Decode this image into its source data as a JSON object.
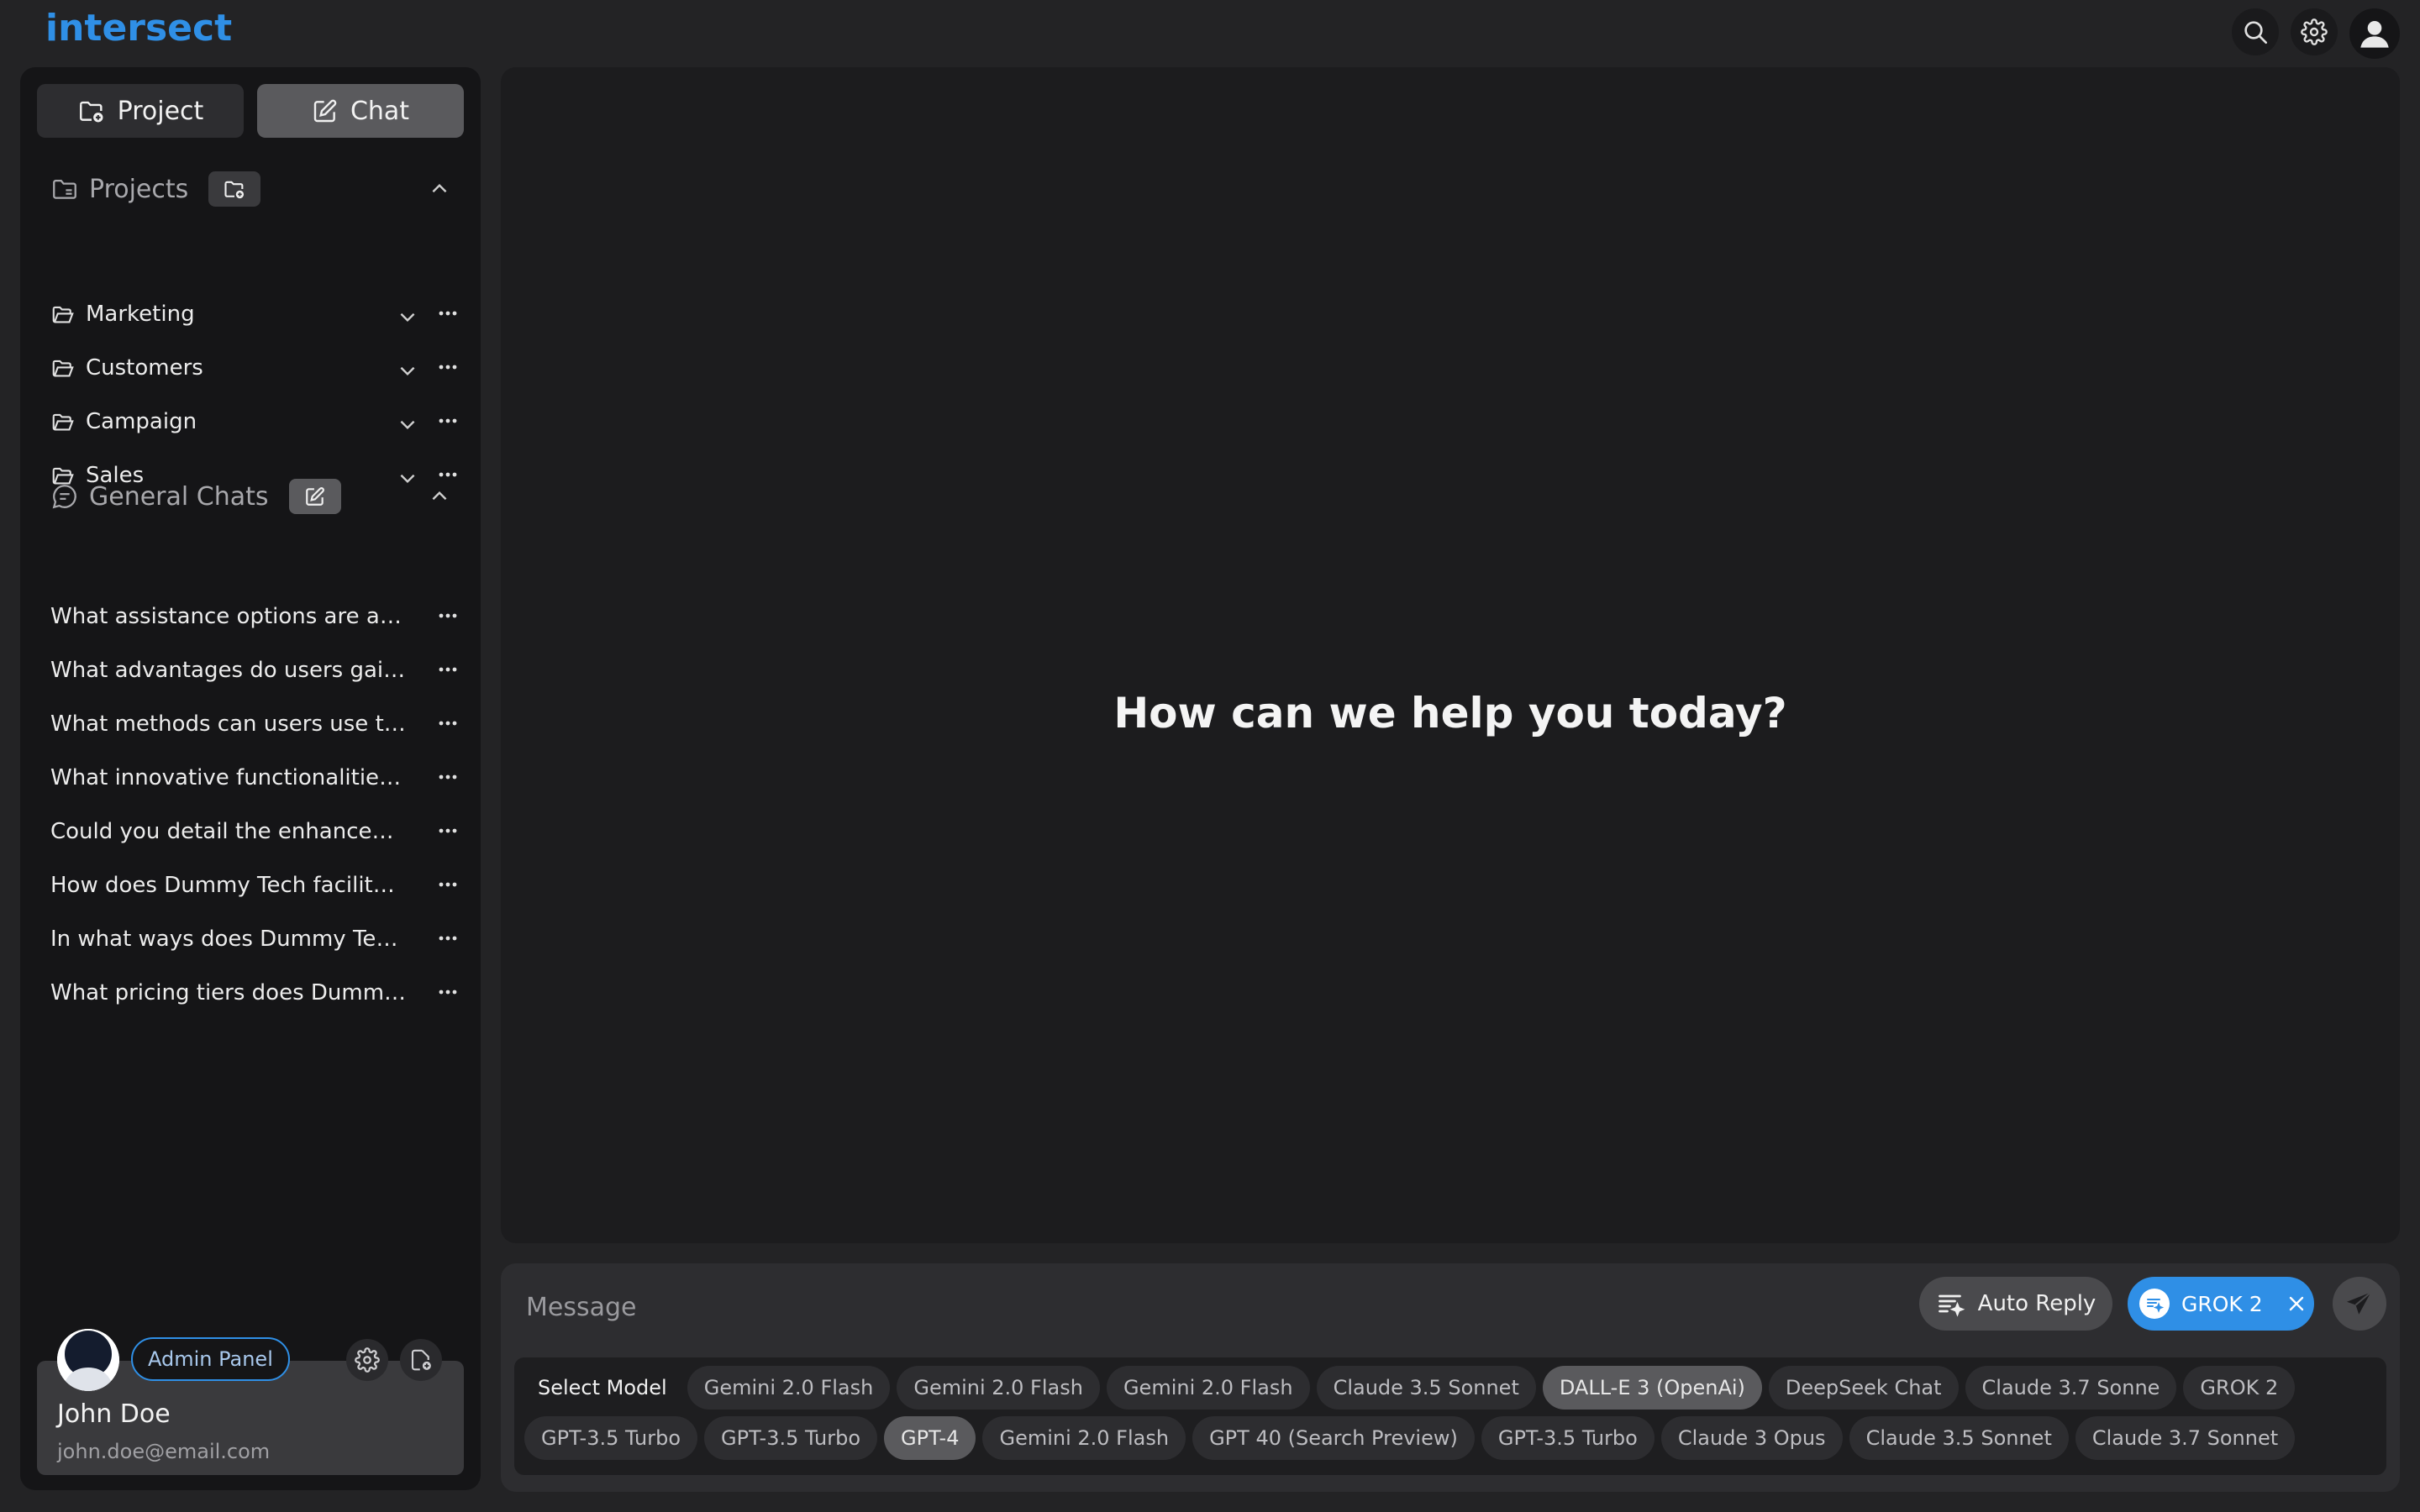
{
  "app": {
    "logo": "intersect"
  },
  "topbar": {
    "icons": [
      "search-icon",
      "gear-icon",
      "user-icon"
    ]
  },
  "sidebar": {
    "tabs": [
      {
        "label": "Project",
        "icon": "folder-add-icon",
        "active": false
      },
      {
        "label": "Chat",
        "icon": "edit-icon",
        "active": true
      }
    ],
    "projects": {
      "title": "Projects",
      "items": [
        {
          "label": "Marketing"
        },
        {
          "label": "Customers"
        },
        {
          "label": "Campaign"
        },
        {
          "label": "Sales"
        }
      ]
    },
    "general_chats": {
      "title": "General Chats",
      "items": [
        {
          "label": "What assistance options are avail..."
        },
        {
          "label": "What advantages do users gain b..."
        },
        {
          "label": "What methods can users use to s..."
        },
        {
          "label": "What innovative functionalities do..."
        },
        {
          "label": "Could you detail the enhancemen..."
        },
        {
          "label": "How does Dummy Tech facilitate i..."
        },
        {
          "label": "In what ways does Dummy Tech p..."
        },
        {
          "label": "What pricing tiers does Dummy T..."
        }
      ]
    },
    "user": {
      "admin_label": "Admin Panel",
      "name": "John Doe",
      "email": "john.doe@email.com"
    }
  },
  "main": {
    "welcome": "How can we help you today?"
  },
  "composer": {
    "placeholder": "Message",
    "auto_reply_label": "Auto Reply",
    "active_model": "GROK 2",
    "model_select_label": "Select Model",
    "model_rows": [
      [
        {
          "label": "Gemini 2.0 Flash",
          "selected": false
        },
        {
          "label": "Gemini 2.0 Flash",
          "selected": false
        },
        {
          "label": "Gemini 2.0 Flash",
          "selected": false
        },
        {
          "label": "Claude 3.5 Sonnet",
          "selected": false
        },
        {
          "label": "DALL-E 3 (OpenAi)",
          "selected": true
        },
        {
          "label": "DeepSeek Chat",
          "selected": false
        },
        {
          "label": "Claude 3.7 Sonne",
          "selected": false
        },
        {
          "label": "GROK 2",
          "selected": false
        }
      ],
      [
        {
          "label": "GPT-3.5 Turbo",
          "selected": false
        },
        {
          "label": "GPT-3.5 Turbo",
          "selected": false
        },
        {
          "label": "GPT-4",
          "selected": true
        },
        {
          "label": "Gemini 2.0 Flash",
          "selected": false
        },
        {
          "label": "GPT 40 (Search Preview)",
          "selected": false
        },
        {
          "label": "GPT-3.5 Turbo",
          "selected": false
        },
        {
          "label": "Claude 3 Opus",
          "selected": false
        },
        {
          "label": "Claude 3.5 Sonnet",
          "selected": false
        },
        {
          "label": "Claude 3.7 Sonnet",
          "selected": false
        }
      ]
    ]
  },
  "colors": {
    "accent": "#2f8fe6",
    "background": "#232325",
    "sidebar": "#151517",
    "panel": "#1c1c1e"
  }
}
